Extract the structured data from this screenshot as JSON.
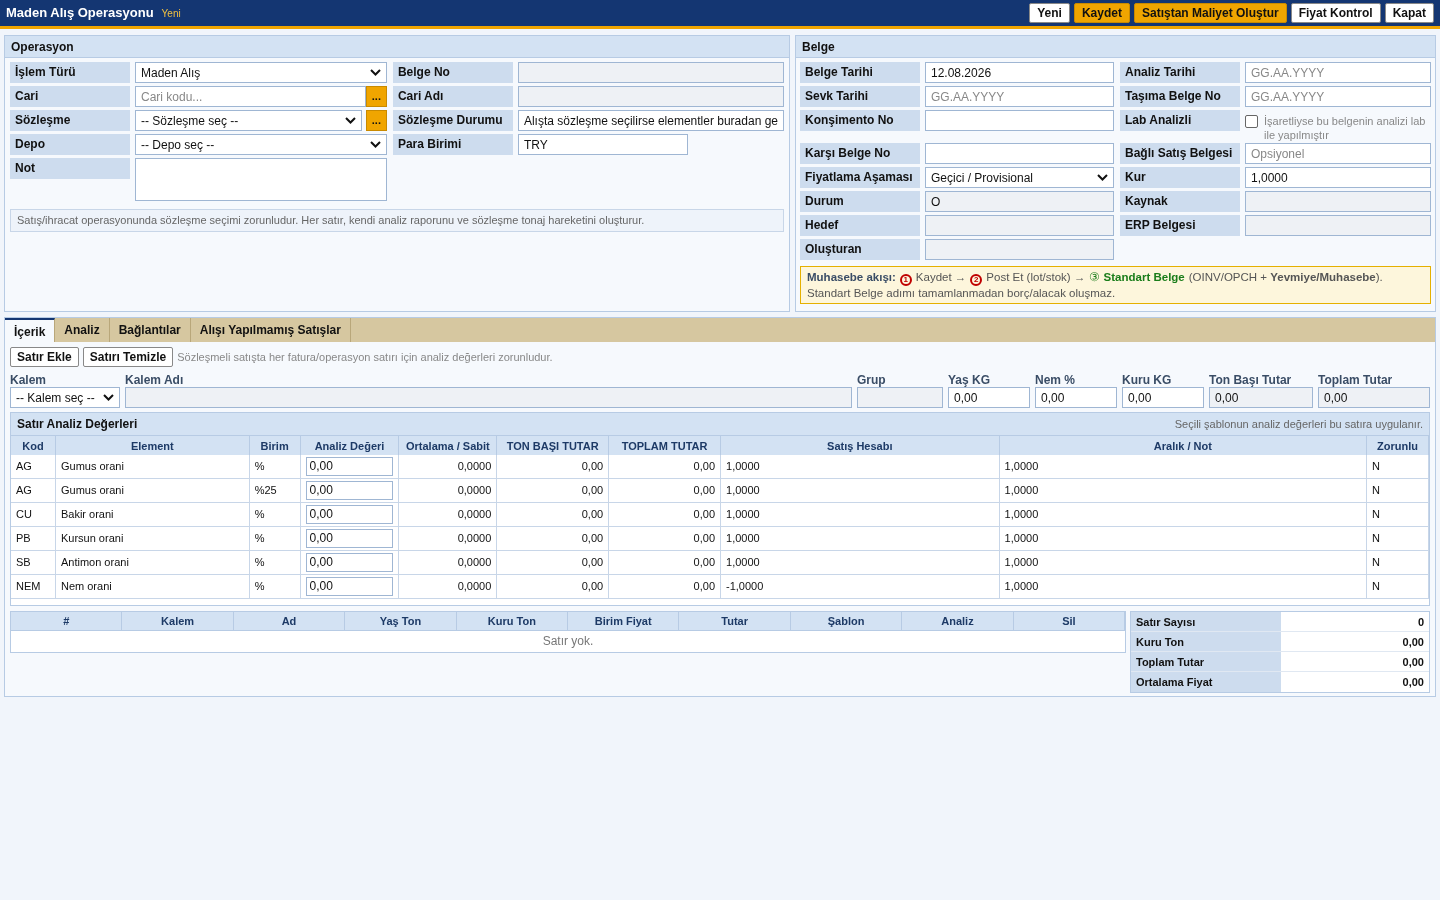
{
  "header": {
    "title": "Maden Alış Operasyonu",
    "badge": "Yeni",
    "buttons": [
      {
        "label": "Yeni",
        "kind": "default"
      },
      {
        "label": "Kaydet",
        "kind": "primary"
      },
      {
        "label": "Satıştan Maliyet Oluştur",
        "kind": "primary"
      },
      {
        "label": "Fiyat Kontrol",
        "kind": "default"
      },
      {
        "label": "Kapat",
        "kind": "default"
      }
    ]
  },
  "operasyon": {
    "title": "Operasyon",
    "left_fields": [
      {
        "label": "İşlem Türü",
        "kind": "select",
        "value": "Maden Alış"
      },
      {
        "label": "Cari",
        "kind": "input_lookup",
        "placeholder": "Cari kodu...",
        "button": "..."
      },
      {
        "label": "Sözleşme",
        "kind": "select_lookup",
        "value": "-- Sözleşme seç --",
        "button": "..."
      },
      {
        "label": "Depo",
        "kind": "select",
        "value": "-- Depo seç --"
      },
      {
        "label": "Not",
        "kind": "textarea"
      }
    ],
    "right_fields": [
      {
        "label": "Belge No",
        "kind": "readonly"
      },
      {
        "label": "Cari Adı",
        "kind": "readonly"
      },
      {
        "label": "Sözleşme Durumu",
        "kind": "text",
        "value": "Alışta sözleşme seçilirse elementler buradan ge"
      },
      {
        "label": "Para Birimi",
        "kind": "short",
        "value": "TRY"
      }
    ],
    "note": "Satış/ihracat operasyonunda sözleşme seçimi zorunludur. Her satır, kendi analiz raporunu ve sözleşme tonaj hareketini oluşturur."
  },
  "belge": {
    "title": "Belge",
    "left_fields": [
      {
        "label": "Belge Tarihi",
        "kind": "text",
        "value": "12.08.2026"
      },
      {
        "label": "Sevk Tarihi",
        "kind": "text",
        "placeholder": "GG.AA.YYYY"
      },
      {
        "label": "Konşimento No",
        "kind": "text"
      },
      {
        "label": "Karşı Belge No",
        "kind": "text"
      },
      {
        "label": "Fiyatlama Aşaması",
        "kind": "select",
        "value": "Geçici / Provisional"
      },
      {
        "label": "Durum",
        "kind": "readonly",
        "value": "O"
      },
      {
        "label": "Hedef",
        "kind": "readonly"
      },
      {
        "label": "Oluşturan",
        "kind": "readonly"
      }
    ],
    "right_fields": [
      {
        "label": "Analiz Tarihi",
        "kind": "text",
        "placeholder": "GG.AA.YYYY"
      },
      {
        "label": "Taşıma Belge No",
        "kind": "text",
        "placeholder": "GG.AA.YYYY"
      },
      {
        "label": "Lab Analizli",
        "kind": "checkbox",
        "checked": false,
        "text": "İşaretliyse bu belgenin analizi lab ile yapılmıştır"
      },
      {
        "label": "Bağlı Satış Belgesi",
        "kind": "text",
        "placeholder": "Opsiyonel"
      },
      {
        "label": "Kur",
        "kind": "text",
        "value": "1,0000"
      },
      {
        "label": "Kaynak",
        "kind": "readonly"
      },
      {
        "label": "ERP Belgesi",
        "kind": "readonly"
      }
    ],
    "flow": [
      {
        "text": "**Muhasebe akışı:**",
        "color": "#3a4d66"
      },
      {
        "kind": "step_number",
        "text": "1",
        "color": "#c00000"
      },
      {
        "text": "Kaydet →",
        "color": "#555555"
      },
      {
        "kind": "step_number",
        "text": "2",
        "color": "#c00000"
      },
      {
        "text": "Post Et (lot/stok) →",
        "color": "#555555"
      },
      {
        "text": "③ **Standart Belge**",
        "color": "#1a7d1a"
      },
      {
        "text": "(OINV/OPCH + **Yevmiye/Muhasebe**).",
        "color": "#555555"
      }
    ],
    "flow_note": "Standart Belge adımı tamamlanmadan borç/alacak oluşmaz."
  },
  "tabs": [
    {
      "label": "İçerik",
      "selected": true
    },
    {
      "label": "Analiz",
      "selected": false
    },
    {
      "label": "Bağlantılar",
      "selected": false
    },
    {
      "label": "Alışı Yapılmamış Satışlar",
      "selected": false
    }
  ],
  "toolbar": {
    "buttons": [
      "Satır Ekle",
      "Satırı Temizle"
    ],
    "hint": "Sözleşmeli satışta her fatura/operasyon satırı için analiz değerleri zorunludur."
  },
  "line_fields": [
    {
      "label": "Kalem",
      "kind": "select",
      "value": "-- Kalem seç --"
    },
    {
      "label": "Kalem Adı",
      "kind": "readonly"
    },
    {
      "label": "Grup",
      "kind": "readonly"
    },
    {
      "label": "Yaş KG",
      "kind": "text",
      "value": "0,00"
    },
    {
      "label": "Nem %",
      "kind": "text",
      "value": "0,00"
    },
    {
      "label": "Kuru KG",
      "kind": "text",
      "value": "0,00"
    },
    {
      "label": "Ton Başı Tutar",
      "kind": "readonly",
      "value": "0,00"
    },
    {
      "label": "Toplam Tutar",
      "kind": "readonly",
      "value": "0,00"
    }
  ],
  "analysis": {
    "title": "Satır Analiz Değerleri",
    "hint": "Seçili şablonun analiz değerleri bu satıra uygulanır.",
    "columns": [
      "Kod",
      "Element",
      "Birim",
      "Analiz Değeri",
      "Ortalama / Sabit",
      "TON BAŞI TUTAR",
      "TOPLAM TUTAR",
      "Satış Hesabı",
      "Aralık / Not",
      "Zorunlu"
    ],
    "rows": [
      [
        "AG",
        "Gumus orani",
        "%",
        "0,00",
        "0,0000",
        "0,00",
        "0,00",
        "1,0000",
        "1,0000",
        "N"
      ],
      [
        "AG",
        "Gumus orani",
        "%25",
        "0,00",
        "0,0000",
        "0,00",
        "0,00",
        "1,0000",
        "1,0000",
        "N"
      ],
      [
        "CU",
        "Bakir orani",
        "%",
        "0,00",
        "0,0000",
        "0,00",
        "0,00",
        "1,0000",
        "1,0000",
        "N"
      ],
      [
        "PB",
        "Kursun orani",
        "%",
        "0,00",
        "0,0000",
        "0,00",
        "0,00",
        "1,0000",
        "1,0000",
        "N"
      ],
      [
        "SB",
        "Antimon orani",
        "%",
        "0,00",
        "0,0000",
        "0,00",
        "0,00",
        "1,0000",
        "1,0000",
        "N"
      ],
      [
        "NEM",
        "Nem orani",
        "%",
        "0,00",
        "0,0000",
        "0,00",
        "0,00",
        "-1,0000",
        "1,0000",
        "N"
      ]
    ]
  },
  "lines": {
    "columns": [
      "#",
      "Kalem",
      "Ad",
      "Yaş Ton",
      "Kuru Ton",
      "Birim Fiyat",
      "Tutar",
      "Şablon",
      "Analiz",
      "Sil"
    ],
    "empty": "Satır yok."
  },
  "summary": [
    {
      "label": "Satır Sayısı",
      "value": "0"
    },
    {
      "label": "Kuru Ton",
      "value": "0,00"
    },
    {
      "label": "Toplam Tutar",
      "value": "0,00"
    },
    {
      "label": "Ortalama Fiyat",
      "value": "0,00"
    }
  ]
}
